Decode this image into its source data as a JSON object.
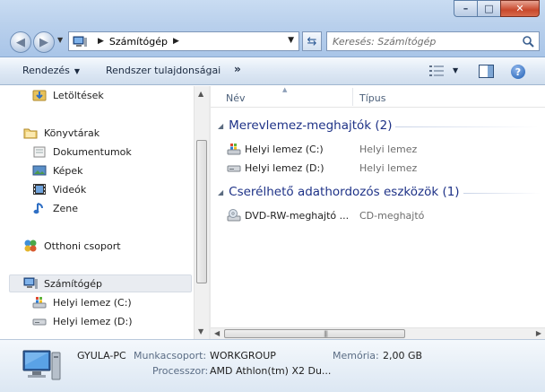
{
  "window": {
    "minimize_glyph": "–",
    "maximize_glyph": "□",
    "close_glyph": "✕"
  },
  "address": {
    "crumb": "Számítógép",
    "search_placeholder": "Keresés: Számítógép"
  },
  "toolbar": {
    "organize": "Rendezés",
    "system_properties": "Rendszer tulajdonságai",
    "more": "»",
    "help": "?"
  },
  "navigation": {
    "items": [
      {
        "label": "Letöltések",
        "icon": "downloads-folder-icon"
      },
      {
        "label": "Könyvtárak",
        "icon": "libraries-icon"
      },
      {
        "label": "Dokumentumok",
        "icon": "documents-icon"
      },
      {
        "label": "Képek",
        "icon": "pictures-icon"
      },
      {
        "label": "Videók",
        "icon": "videos-icon"
      },
      {
        "label": "Zene",
        "icon": "music-icon"
      },
      {
        "label": "Otthoni csoport",
        "icon": "homegroup-icon"
      },
      {
        "label": "Számítógép",
        "icon": "computer-icon",
        "selected": true
      },
      {
        "label": "Helyi lemez (C:)",
        "icon": "system-drive-icon"
      },
      {
        "label": "Helyi lemez (D:)",
        "icon": "drive-icon"
      }
    ]
  },
  "columns": {
    "name": "Név",
    "type": "Típus"
  },
  "groups": [
    {
      "title": "Merevlemez-meghajtók (2)",
      "items": [
        {
          "name": "Helyi lemez (C:)",
          "type": "Helyi lemez"
        },
        {
          "name": "Helyi lemez (D:)",
          "type": "Helyi lemez"
        }
      ]
    },
    {
      "title": "Cserélhető adathordozós eszközök (1)",
      "items": [
        {
          "name": "DVD-RW-meghajtó ...",
          "type": "CD-meghajtó"
        }
      ]
    }
  ],
  "details": {
    "computer_name": "GYULA-PC",
    "workgroup_label": "Munkacsoport:",
    "workgroup_value": "WORKGROUP",
    "memory_label": "Memória:",
    "memory_value": "2,00 GB",
    "processor_label": "Processzor:",
    "processor_value": "AMD Athlon(tm) X2 Du..."
  },
  "colors": {
    "group_header": "#1e3287",
    "type_text": "#6d6d6d",
    "chrome": "#b9d0ec"
  }
}
